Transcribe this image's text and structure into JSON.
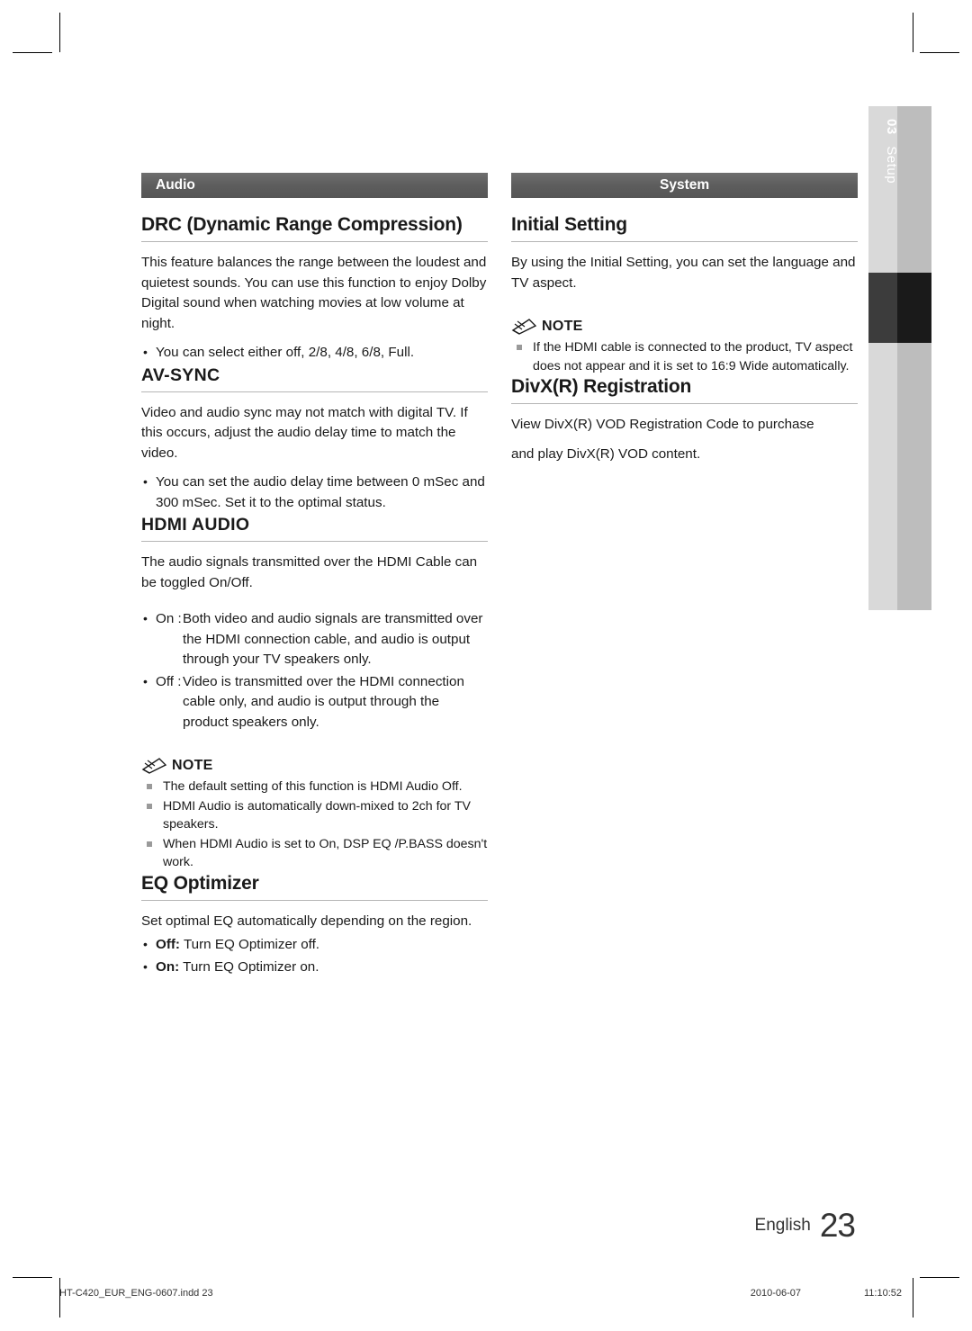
{
  "side_tab": {
    "number": "03",
    "label": "Setup"
  },
  "left_column": {
    "section_header": "Audio",
    "sections": [
      {
        "title": "DRC (Dynamic Range Compression)",
        "body": "This feature balances the range between the loudest and quietest sounds. You can use this function to enjoy Dolby Digital sound when watching movies at low volume at night.",
        "bullets": [
          "You can select either off, 2/8, 4/8, 6/8, Full."
        ]
      },
      {
        "title": "AV-SYNC",
        "body": "Video and audio sync may not match with digital TV. If this occurs, adjust the audio delay time to match the video.",
        "bullets": [
          "You can set the audio delay time between 0 mSec and 300 mSec. Set it to the optimal status."
        ]
      },
      {
        "title": "HDMI AUDIO",
        "body": "The audio signals transmitted over the HDMI Cable can be toggled On/Off.",
        "bullets_labeled": [
          {
            "lead": "On :",
            "text": "Both video and audio signals are transmitted over the HDMI connection cable, and audio is output through your TV speakers only."
          },
          {
            "lead": "Off :",
            "text": "Video is transmitted over the HDMI connection cable only, and audio is output through the product speakers only."
          }
        ],
        "note_label": "NOTE",
        "notes": [
          "The default setting of this function is HDMI Audio Off.",
          "HDMI Audio is automatically down-mixed to 2ch for TV speakers.",
          "When HDMI Audio is set to On, DSP EQ /P.BASS doesn't work."
        ]
      },
      {
        "title": "EQ Optimizer",
        "body": "Set optimal EQ automatically depending on the region.",
        "bullets_labeled": [
          {
            "lead": "Off:",
            "text": "Turn EQ Optimizer off."
          },
          {
            "lead": "On:",
            "text": "Turn EQ Optimizer on."
          }
        ]
      }
    ]
  },
  "right_column": {
    "section_header": "System",
    "sections": [
      {
        "title": "Initial Setting",
        "body": "By using the Initial Setting, you can set the language and TV aspect.",
        "note_label": "NOTE",
        "notes": [
          "If the HDMI cable is connected to the product, TV aspect does not appear and it is set to 16:9 Wide automatically."
        ]
      },
      {
        "title": "DivX(R) Registration",
        "body1": "View DivX(R) VOD Registration Code to purchase",
        "body2": "and play DivX(R) VOD content."
      }
    ]
  },
  "footer": {
    "language": "English",
    "page_number": "23",
    "file_name": "HT-C420_EUR_ENG-0607.indd   23",
    "date": "2010-06-07",
    "time": "11:10:52"
  }
}
